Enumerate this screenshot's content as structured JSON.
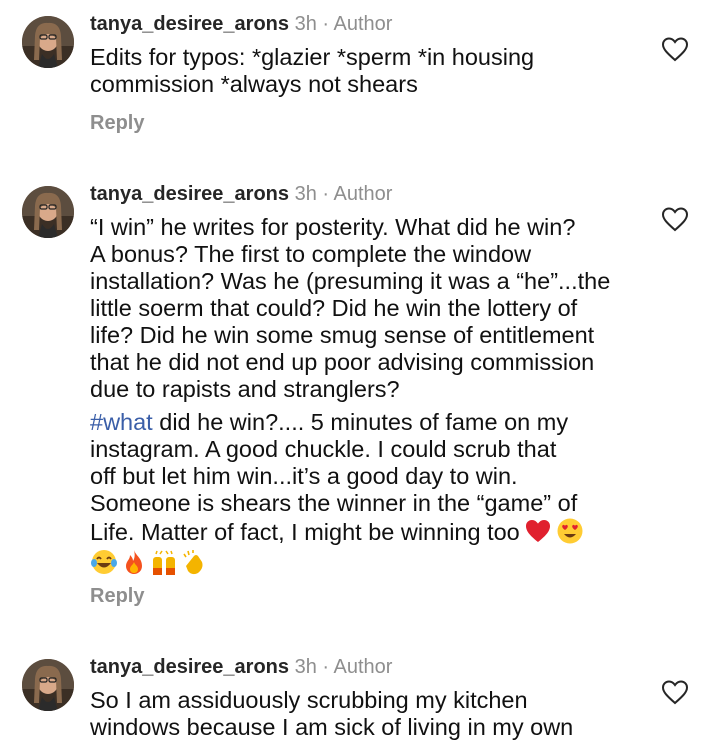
{
  "colors": {
    "text": "#111111",
    "username": "#262626",
    "muted": "#8e8e8e",
    "hashtag": "#3a5ea8"
  },
  "icons": {
    "like": "heart-outline-icon",
    "heart": "red-heart-emoji",
    "heart_eyes": "heart-eyes-emoji",
    "joy": "tears-of-joy-emoji",
    "fire": "fire-emoji",
    "raised_hands": "raised-hands-emoji",
    "clapping": "clapping-hands-emoji"
  },
  "comments": [
    {
      "username": "tanya_desiree_arons",
      "time": "3h",
      "separator": "·",
      "badge": "Author",
      "text": "Edits for typos: *glazier *sperm *in housing\ncommission *always not shears",
      "reply_label": "Reply"
    },
    {
      "username": "tanya_desiree_arons",
      "time": "3h",
      "separator": "·",
      "badge": "Author",
      "text": "“I win” he writes for posterity.  What did he win?\nA bonus? The first to complete the window\ninstallation? Was he (presuming it was a “he”...the\nlittle soerm that could? Did he win the lottery of\nlife? Did he win some smug sense of entitlement\nthat he did not end up poor advising commission\ndue to rapists and stranglers?",
      "hashtag": "#what",
      "text2": " did he win?.... 5 minutes of fame on my\ninstagram.  A good chuckle.  I could scrub that\noff but let him win...it’s a good day to win.\nSomeone is shears the winner in the “game” of\nLife.  Matter of fact, I might be winning too",
      "reply_label": "Reply"
    },
    {
      "username": "tanya_desiree_arons",
      "time": "3h",
      "separator": "·",
      "badge": "Author",
      "text": "So I am assiduously scrubbing my kitchen\nwindows because I am sick of living in my own"
    }
  ]
}
